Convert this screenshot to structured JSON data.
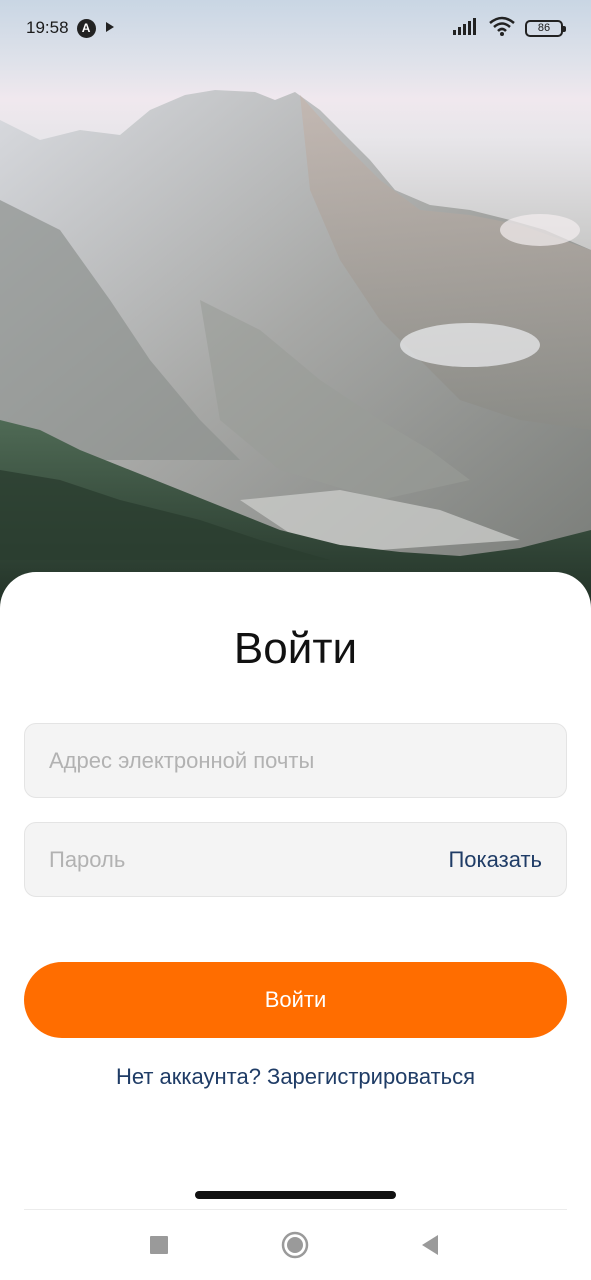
{
  "status_bar": {
    "time": "19:58",
    "app_icon": "a-circle-icon",
    "play_icon": "play-store-icon",
    "signal_icon": "cellular-signal-icon",
    "wifi_icon": "wifi-icon",
    "battery_level": "86"
  },
  "login": {
    "title": "Войти",
    "email_placeholder": "Адрес электронной почты",
    "email_value": "",
    "password_placeholder": "Пароль",
    "password_value": "",
    "show_password_label": "Показать",
    "submit_label": "Войти",
    "register_link": "Нет аккаунта? Зарегистрироваться"
  },
  "theme": {
    "accent": "#ff6d00",
    "link": "#1f3c66",
    "field_bg": "#f4f4f4",
    "placeholder": "#b2b2b2"
  },
  "nav": {
    "recents_icon": "square-recents-icon",
    "home_icon": "circle-home-icon",
    "back_icon": "triangle-back-icon"
  }
}
